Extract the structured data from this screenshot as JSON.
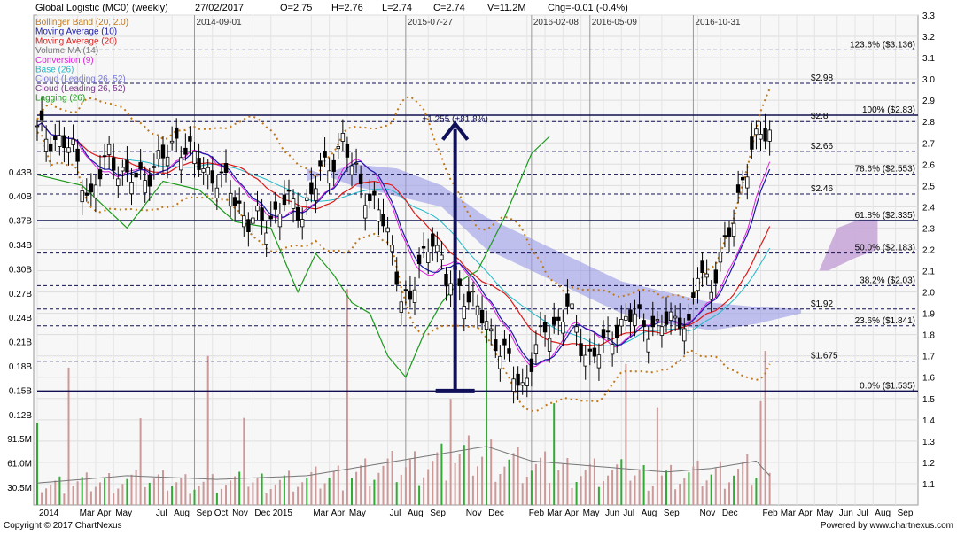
{
  "header": {
    "title": "Global Logistic (MC0) (weekly)",
    "date": "27/02/2017",
    "open": "O=2.75",
    "high": "H=2.76",
    "low": "L=2.74",
    "close": "C=2.74",
    "volume": "V=11.2M",
    "change": "Chg=-0.01 (-0.4%)"
  },
  "footer": {
    "copyright": "Copyright © 2017 ChartNexus",
    "powered": "Powered by www.chartnexus.com"
  },
  "colors": {
    "background": "#f7f7f7",
    "candle_body": "#000000",
    "bollinger": "#c07818",
    "ma10": "#1a1aa8",
    "ma20": "#dd1a1a",
    "volume_ma": "#777777",
    "conversion": "#e020e0",
    "base": "#20b8c8",
    "cloud": "#9a9ae6",
    "cloud_bear": "#c8a8d8",
    "lagging": "#1a9a1a",
    "volume_bar": "#cc9999",
    "volume_bar_green": "#33aa33",
    "level_line": "#101050"
  },
  "chart_data": {
    "type": "candlestick",
    "title": "Global Logistic (MC0) (weekly)",
    "ylim": [
      1.0,
      3.3
    ],
    "y_ticks": [
      "1.1",
      "1.2",
      "1.3",
      "1.4",
      "1.5",
      "1.6",
      "1.7",
      "1.8",
      "1.9",
      "2.0",
      "2.1",
      "2.2",
      "2.3",
      "2.4",
      "2.5",
      "2.6",
      "2.7",
      "2.8",
      "2.9",
      "3.0",
      "3.1",
      "3.2",
      "3.3"
    ],
    "volume_ticks": [
      "30.5M",
      "61.0M",
      "91.5M",
      "0.12B",
      "0.15B",
      "0.18B",
      "0.21B",
      "0.24B",
      "0.27B",
      "0.30B",
      "0.34B",
      "0.37B",
      "0.40B",
      "0.43B"
    ],
    "x_ticks": [
      {
        "label": "2014",
        "t": 0
      },
      {
        "label": "Mar",
        "t": 9
      },
      {
        "label": "Apr",
        "t": 13
      },
      {
        "label": "May",
        "t": 17
      },
      {
        "label": "Jul",
        "t": 26
      },
      {
        "label": "Aug",
        "t": 30
      },
      {
        "label": "Sep",
        "t": 35
      },
      {
        "label": "Oct",
        "t": 39
      },
      {
        "label": "Nov",
        "t": 43
      },
      {
        "label": "Dec",
        "t": 48
      },
      {
        "label": "2015",
        "t": 52
      },
      {
        "label": "Mar",
        "t": 61
      },
      {
        "label": "Apr",
        "t": 65
      },
      {
        "label": "May",
        "t": 69
      },
      {
        "label": "Jul",
        "t": 78
      },
      {
        "label": "Aug",
        "t": 82
      },
      {
        "label": "Sep",
        "t": 87
      },
      {
        "label": "Nov",
        "t": 95
      },
      {
        "label": "Dec",
        "t": 100
      },
      {
        "label": "Feb",
        "t": 109
      },
      {
        "label": "Mar",
        "t": 113
      },
      {
        "label": "Apr",
        "t": 117
      },
      {
        "label": "May",
        "t": 121
      },
      {
        "label": "Jun",
        "t": 126
      },
      {
        "label": "Jul",
        "t": 130
      },
      {
        "label": "Aug",
        "t": 134
      },
      {
        "label": "Sep",
        "t": 139
      },
      {
        "label": "Nov",
        "t": 147
      },
      {
        "label": "Dec",
        "t": 152
      },
      {
        "label": "Feb",
        "t": 161
      },
      {
        "label": "Mar",
        "t": 165
      },
      {
        "label": "Apr",
        "t": 169
      },
      {
        "label": "May",
        "t": 173
      },
      {
        "label": "Jun",
        "t": 178
      },
      {
        "label": "Jul",
        "t": 182
      },
      {
        "label": "Aug",
        "t": 186
      },
      {
        "label": "Sep",
        "t": 191
      }
    ],
    "date_markers": [
      {
        "label": "2014-09-01",
        "t": 35
      },
      {
        "label": "2015-07-27",
        "t": 82
      },
      {
        "label": "2016-02-08",
        "t": 110
      },
      {
        "label": "2016-05-09",
        "t": 123
      },
      {
        "label": "2016-10-31",
        "t": 146
      }
    ],
    "legend": [
      {
        "name": "Bollinger Band (20, 2.0)",
        "color": "#c07818"
      },
      {
        "name": "Moving Average (10)",
        "color": "#1a1aa8"
      },
      {
        "name": "Moving Average (20)",
        "color": "#dd1a1a"
      },
      {
        "name": "Volume MA (14)",
        "color": "#777777"
      },
      {
        "name": "Conversion (9)",
        "color": "#e020e0"
      },
      {
        "name": "Base (26)",
        "color": "#20b8c8"
      },
      {
        "name": "Cloud (Leading 26, 52)",
        "color": "#7a7ad8"
      },
      {
        "name": "Cloud (Leading 26, 52)",
        "color": "#7a3a8a"
      },
      {
        "name": "Lagging (26)",
        "color": "#1a9a1a"
      }
    ],
    "fib_levels": [
      {
        "label": "123.6%  ($3.136)",
        "value": 3.136
      },
      {
        "label": "100%  ($2.83)",
        "value": 2.83
      },
      {
        "label": "78.6%  ($2.553)",
        "value": 2.553
      },
      {
        "label": "61.8%  ($2.335)",
        "value": 2.335
      },
      {
        "label": "50.0%  ($2.183)",
        "value": 2.183
      },
      {
        "label": "38.2%  ($2.03)",
        "value": 2.03
      },
      {
        "label": "23.6%  ($1.841)",
        "value": 1.841
      },
      {
        "label": "0.0%  ($1.535)",
        "value": 1.535
      }
    ],
    "price_levels": [
      {
        "label": "$2.98",
        "value": 2.98
      },
      {
        "label": "$2.8",
        "value": 2.8
      },
      {
        "label": "$2.66",
        "value": 2.66
      },
      {
        "label": "$2.46",
        "value": 2.46
      },
      {
        "label": "$1.92",
        "value": 1.92
      },
      {
        "label": "$1.675",
        "value": 1.675
      }
    ],
    "annotation": "+1.255 (+81.8%)",
    "arrow": {
      "t": 93,
      "from": 1.535,
      "to": 2.79
    },
    "close_keypoints": [
      [
        0,
        2.75
      ],
      [
        4,
        2.72
      ],
      [
        8,
        2.66
      ],
      [
        12,
        2.43
      ],
      [
        16,
        2.66
      ],
      [
        20,
        2.52
      ],
      [
        24,
        2.55
      ],
      [
        28,
        2.62
      ],
      [
        31,
        2.72
      ],
      [
        35,
        2.62
      ],
      [
        39,
        2.55
      ],
      [
        43,
        2.48
      ],
      [
        47,
        2.33
      ],
      [
        51,
        2.33
      ],
      [
        55,
        2.42
      ],
      [
        59,
        2.38
      ],
      [
        63,
        2.55
      ],
      [
        66,
        2.63
      ],
      [
        68,
        2.72
      ],
      [
        70,
        2.58
      ],
      [
        73,
        2.48
      ],
      [
        76,
        2.38
      ],
      [
        79,
        2.2
      ],
      [
        81,
        2.0
      ],
      [
        83,
        1.93
      ],
      [
        85,
        2.12
      ],
      [
        88,
        2.28
      ],
      [
        91,
        2.03
      ],
      [
        93,
        2.08
      ],
      [
        96,
        1.96
      ],
      [
        100,
        1.86
      ],
      [
        103,
        1.73
      ],
      [
        106,
        1.62
      ],
      [
        108,
        1.56
      ],
      [
        110,
        1.67
      ],
      [
        113,
        1.82
      ],
      [
        116,
        1.86
      ],
      [
        118,
        1.93
      ],
      [
        121,
        1.76
      ],
      [
        123,
        1.7
      ],
      [
        126,
        1.73
      ],
      [
        129,
        1.84
      ],
      [
        132,
        1.88
      ],
      [
        135,
        1.86
      ],
      [
        138,
        1.83
      ],
      [
        141,
        1.86
      ],
      [
        143,
        1.9
      ],
      [
        145,
        1.82
      ],
      [
        147,
        2.08
      ],
      [
        150,
        2.05
      ],
      [
        152,
        2.15
      ],
      [
        155,
        2.33
      ],
      [
        157,
        2.55
      ],
      [
        159,
        2.66
      ],
      [
        161,
        2.73
      ],
      [
        163,
        2.75
      ]
    ],
    "volume_keypoints": [
      [
        0,
        0.03
      ],
      [
        20,
        0.04
      ],
      [
        40,
        0.035
      ],
      [
        60,
        0.04
      ],
      [
        80,
        0.06
      ],
      [
        90,
        0.07
      ],
      [
        100,
        0.08
      ],
      [
        110,
        0.06
      ],
      [
        120,
        0.055
      ],
      [
        130,
        0.05
      ],
      [
        140,
        0.045
      ],
      [
        150,
        0.05
      ],
      [
        160,
        0.06
      ],
      [
        163,
        0.04
      ]
    ],
    "cloud_upper": [
      [
        60,
        2.52
      ],
      [
        70,
        2.6
      ],
      [
        80,
        2.58
      ],
      [
        90,
        2.5
      ],
      [
        100,
        2.35
      ],
      [
        110,
        2.25
      ],
      [
        120,
        2.15
      ],
      [
        130,
        2.05
      ],
      [
        140,
        2.0
      ],
      [
        150,
        1.95
      ],
      [
        160,
        1.93
      ],
      [
        170,
        1.92
      ]
    ],
    "cloud_lower": [
      [
        60,
        2.58
      ],
      [
        70,
        2.5
      ],
      [
        80,
        2.45
      ],
      [
        90,
        2.4
      ],
      [
        100,
        2.2
      ],
      [
        110,
        2.1
      ],
      [
        120,
        2.0
      ],
      [
        130,
        1.9
      ],
      [
        140,
        1.85
      ],
      [
        150,
        1.82
      ],
      [
        160,
        1.85
      ],
      [
        170,
        1.9
      ]
    ],
    "lagging": [
      [
        0,
        2.55
      ],
      [
        10,
        2.5
      ],
      [
        20,
        2.3
      ],
      [
        28,
        2.52
      ],
      [
        36,
        2.48
      ],
      [
        44,
        2.33
      ],
      [
        52,
        2.3
      ],
      [
        58,
        2.0
      ],
      [
        62,
        2.18
      ],
      [
        66,
        2.08
      ],
      [
        70,
        1.95
      ],
      [
        74,
        1.9
      ],
      [
        78,
        1.7
      ],
      [
        82,
        1.6
      ],
      [
        86,
        1.8
      ],
      [
        90,
        1.95
      ],
      [
        94,
        2.05
      ],
      [
        98,
        2.1
      ],
      [
        104,
        2.35
      ],
      [
        110,
        2.65
      ],
      [
        114,
        2.73
      ]
    ]
  }
}
